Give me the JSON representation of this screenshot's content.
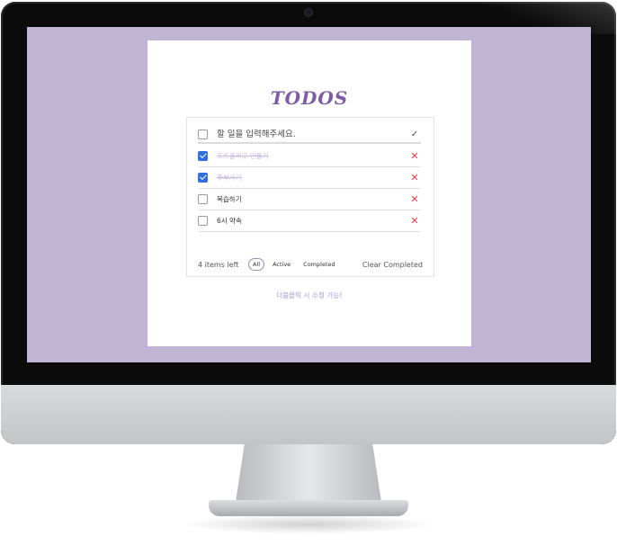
{
  "app": {
    "title": "TODOS"
  },
  "new_todo": {
    "placeholder": "할 일을 입력해주세요.",
    "confirm_icon": "check-icon"
  },
  "todos": [
    {
      "text": "포트폴리오 만들기",
      "completed": true
    },
    {
      "text": "주부사기",
      "completed": true
    },
    {
      "text": "복습하기",
      "completed": false
    },
    {
      "text": "6시 약속",
      "completed": false
    }
  ],
  "footer": {
    "items_left": "4 items left",
    "filters": [
      "All",
      "Active",
      "Completed"
    ],
    "active_filter": "All",
    "clear_label": "Clear Completed"
  },
  "hint": "더블클릭 시 수정 가능!",
  "colors": {
    "screen_bg": "#c1b5d6",
    "title": "#7f5aa8",
    "checkbox_checked": "#2f6fe0",
    "delete": "#e33b4b",
    "done_text": "#c9b9e0"
  }
}
